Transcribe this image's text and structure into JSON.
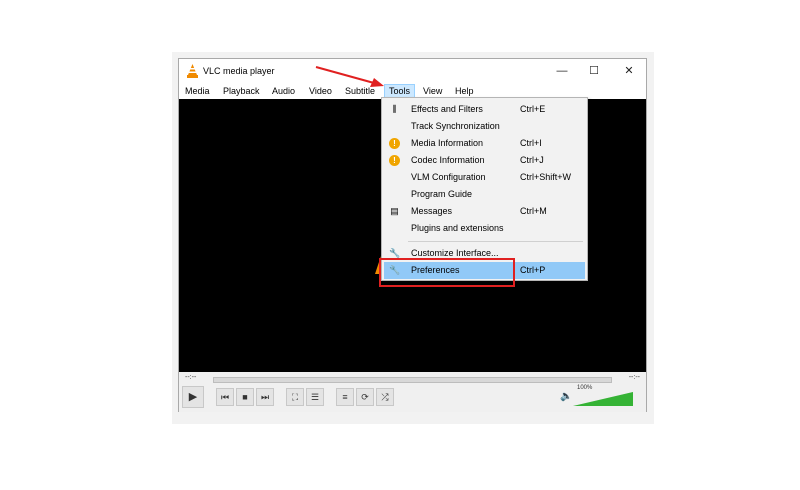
{
  "window": {
    "title": "VLC media player",
    "controls": {
      "minimize": "—",
      "maximize": "☐",
      "close": "✕"
    }
  },
  "menubar": {
    "items": [
      {
        "label": "Media"
      },
      {
        "label": "Playback"
      },
      {
        "label": "Audio"
      },
      {
        "label": "Video"
      },
      {
        "label": "Subtitle"
      },
      {
        "label": "Tools"
      },
      {
        "label": "View"
      },
      {
        "label": "Help"
      }
    ],
    "active": "Tools"
  },
  "tools_menu": {
    "items": [
      {
        "label": "Effects and Filters",
        "shortcut": "Ctrl+E",
        "icon": "equalizer-icon"
      },
      {
        "label": "Track Synchronization",
        "shortcut": "",
        "icon": ""
      },
      {
        "label": "Media Information",
        "shortcut": "Ctrl+I",
        "icon": "info-icon"
      },
      {
        "label": "Codec Information",
        "shortcut": "Ctrl+J",
        "icon": "info-icon"
      },
      {
        "label": "VLM Configuration",
        "shortcut": "Ctrl+Shift+W",
        "icon": ""
      },
      {
        "label": "Program Guide",
        "shortcut": "",
        "icon": ""
      },
      {
        "label": "Messages",
        "shortcut": "Ctrl+M",
        "icon": "messages-icon"
      },
      {
        "label": "Plugins and extensions",
        "shortcut": "",
        "icon": ""
      },
      {
        "label": "Customize Interface...",
        "shortcut": "",
        "icon": "wrench-icon"
      },
      {
        "label": "Preferences",
        "shortcut": "Ctrl+P",
        "icon": "wrench-icon"
      }
    ],
    "highlighted": "Preferences"
  },
  "player": {
    "time_elapsed": "--:--",
    "time_total": "--:--",
    "volume_label": "100%",
    "volume_level": 1.0
  },
  "colors": {
    "annotation": "#e02020",
    "highlight": "#91c9f7",
    "video_bg": "#000000",
    "vlc_orange": "#f08a00"
  }
}
